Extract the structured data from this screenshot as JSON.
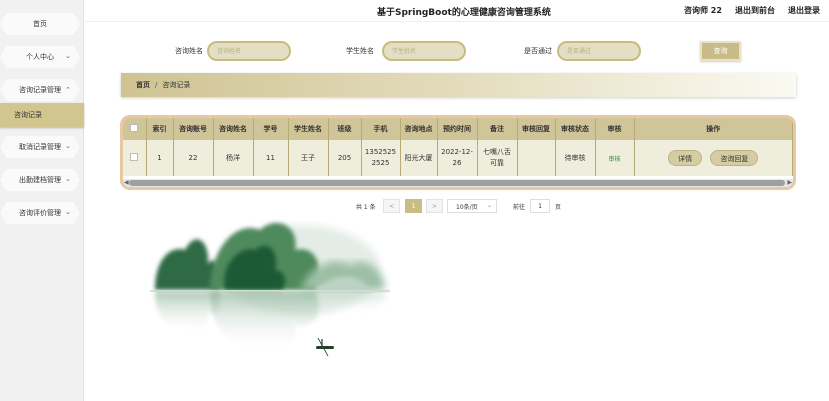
{
  "header": {
    "title": "基于SpringBoot的心理健康咨询管理系统",
    "user": "咨询师 22",
    "front_link": "退出到前台",
    "logout": "退出登录"
  },
  "sidebar": {
    "items": [
      {
        "label": "首页"
      },
      {
        "label": "个人中心"
      },
      {
        "label": "咨询记录管理"
      },
      {
        "label": "取消记录管理"
      },
      {
        "label": "出勤建档管理"
      },
      {
        "label": "咨询评价管理"
      }
    ],
    "sub_active": "咨询记录"
  },
  "search": {
    "field1_label": "咨询姓名",
    "field1_placeholder": "咨询姓名",
    "field2_label": "学生姓名",
    "field2_placeholder": "学生姓名",
    "field3_label": "是否通过",
    "field3_placeholder": "是否通过",
    "button": "查询"
  },
  "breadcrumb": {
    "home": "首页",
    "sep": "/",
    "current": "咨询记录"
  },
  "table": {
    "headers": [
      "索引",
      "咨询账号",
      "咨询姓名",
      "学号",
      "学生姓名",
      "班级",
      "手机",
      "咨询地点",
      "预约时间",
      "备注",
      "审核回复",
      "审核状态",
      "审核",
      "操作"
    ],
    "rows": [
      {
        "index": "1",
        "account": "22",
        "counselor": "杨洋",
        "student_id": "11",
        "student_name": "王子",
        "class": "205",
        "phone": "13525252525",
        "place": "阳光大厦",
        "time": "2022-12-26",
        "remark": "七嘴八舌可靠",
        "reply": "",
        "status": "待审核",
        "audit": "审核",
        "detail_btn": "详情",
        "reply_btn": "咨询回复"
      }
    ]
  },
  "pager": {
    "total": "共 1 条",
    "prev": "<",
    "current": "1",
    "next": ">",
    "size": "10条/页",
    "goto": "前往",
    "page_value": "1",
    "page_suffix": "页"
  }
}
